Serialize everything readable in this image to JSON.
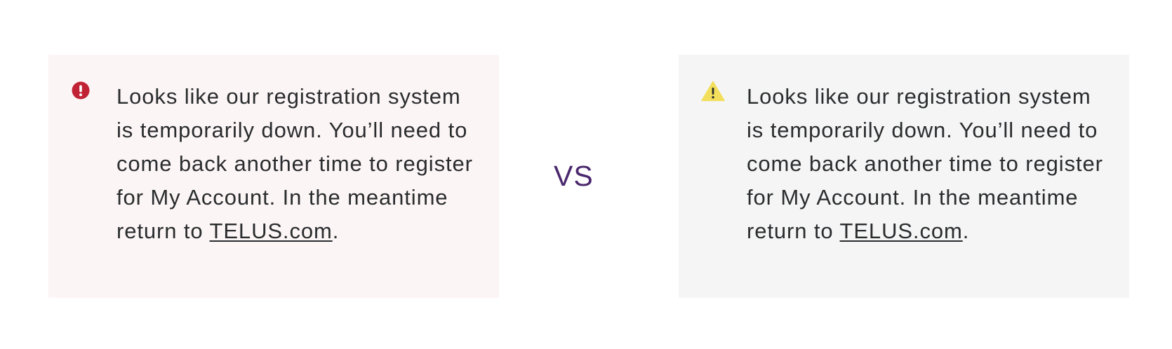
{
  "error_card": {
    "icon": "error-exclamation-circle-icon",
    "icon_color": "#c12335",
    "background": "#fcf5f6",
    "message_text": "Looks like our registration system is temporarily down. You’ll need to come back another time to register for My Account. In the meantime return to ",
    "link_text": "TELUS.com",
    "message_end": "."
  },
  "separator": {
    "label": "VS",
    "color": "#4b286d"
  },
  "warning_card": {
    "icon": "warning-triangle-icon",
    "icon_color": "#f2de5a",
    "background": "#f5f5f5",
    "message_text": "Looks like our registration system is temporarily down. You’ll need to come back another time to register for My Account. In the meantime return to ",
    "link_text": "TELUS.com",
    "message_end": "."
  }
}
